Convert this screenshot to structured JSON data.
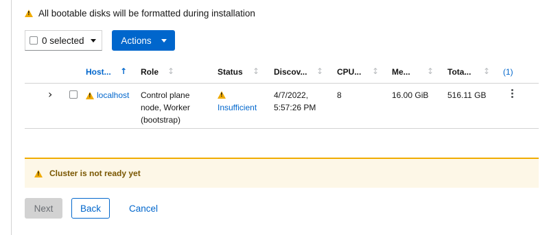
{
  "top_alert": {
    "text": "All bootable disks will be formatted during installation"
  },
  "toolbar": {
    "selected_label": "0 selected",
    "actions_label": "Actions"
  },
  "table": {
    "columns": [
      {
        "label": "Host..."
      },
      {
        "label": "Role"
      },
      {
        "label": "Status"
      },
      {
        "label": "Discov..."
      },
      {
        "label": "CPU..."
      },
      {
        "label": "Me..."
      },
      {
        "label": "Tota..."
      }
    ],
    "column_count_label": "(1)",
    "sort": {
      "column": "Host...",
      "direction": "ascending"
    },
    "rows": [
      {
        "hostname": "localhost",
        "role_lines": [
          "Control plane",
          "node, Worker",
          "(bootstrap)"
        ],
        "status": "Insufficient",
        "discovered_lines": [
          "4/7/2022,",
          "5:57:26 PM"
        ],
        "cpu": "8",
        "memory": "16.00 GiB",
        "total": "516.11 GB"
      }
    ]
  },
  "cluster_alert": {
    "title": "Cluster is not ready yet"
  },
  "footer": {
    "next_label": "Next",
    "back_label": "Back",
    "cancel_label": "Cancel"
  },
  "colors": {
    "accent": "#0066cc",
    "warning": "#f0ab00",
    "warning_bg": "#fdf7e7",
    "warning_text": "#795600"
  },
  "icons": {
    "warning": "warning-triangle-icon",
    "expand": "chevron-right-icon",
    "kebab": "kebab-menu-icon",
    "sort_active": "arrow-up-icon",
    "sort_inactive": "sort-arrows-icon"
  }
}
